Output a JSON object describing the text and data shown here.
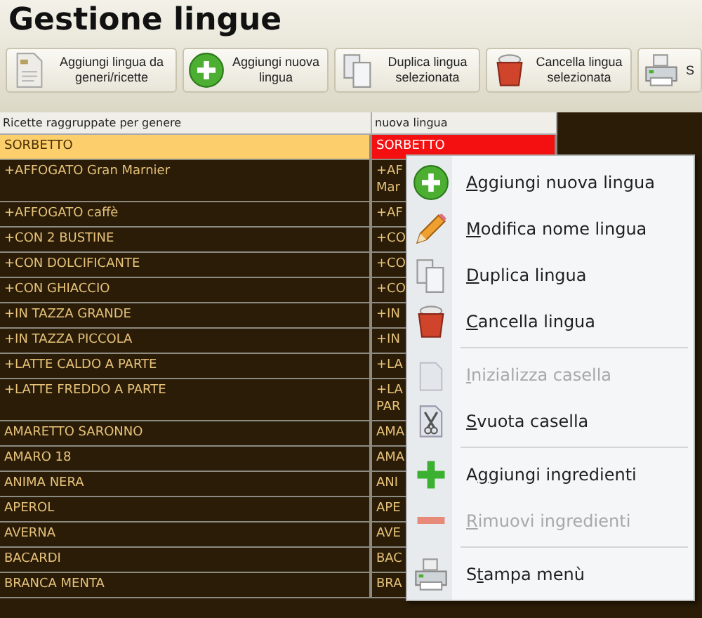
{
  "window": {
    "title": "Gestione lingue"
  },
  "toolbar": [
    {
      "label": "Aggiungi lingua da generi/ricette"
    },
    {
      "label": "Aggiungi nuova lingua"
    },
    {
      "label": "Duplica lingua selezionata"
    },
    {
      "label": "Cancella lingua selezionata"
    },
    {
      "label": "S"
    }
  ],
  "table": {
    "columns": [
      "Ricette raggruppate per genere",
      "nuova lingua"
    ],
    "rows": [
      {
        "name": "SORBETTO",
        "column_2": "SORBETTO",
        "selected": true
      },
      {
        "name": "+AFFOGATO Gran Marnier",
        "column_2": "+AF\nMar",
        "selected": false
      },
      {
        "name": "+AFFOGATO caffè",
        "column_2": "+AF",
        "selected": false
      },
      {
        "name": "+CON 2 BUSTINE",
        "column_2": "+CO",
        "selected": false
      },
      {
        "name": "+CON DOLCIFICANTE",
        "column_2": "+CO",
        "selected": false
      },
      {
        "name": "+CON GHIACCIO",
        "column_2": "+CO",
        "selected": false
      },
      {
        "name": "+IN TAZZA GRANDE",
        "column_2": "+IN",
        "selected": false
      },
      {
        "name": "+IN TAZZA PICCOLA",
        "column_2": "+IN",
        "selected": false
      },
      {
        "name": "+LATTE CALDO A PARTE",
        "column_2": "+LA",
        "selected": false
      },
      {
        "name": "+LATTE FREDDO A PARTE",
        "column_2": "+LA\nPAR",
        "selected": false
      },
      {
        "name": "AMARETTO SARONNO",
        "column_2": "AMA",
        "selected": false
      },
      {
        "name": "AMARO 18",
        "column_2": "AMA",
        "selected": false
      },
      {
        "name": "ANIMA NERA",
        "column_2": "ANI",
        "selected": false
      },
      {
        "name": "APEROL",
        "column_2": "APE",
        "selected": false
      },
      {
        "name": "AVERNA",
        "column_2": "AVE",
        "selected": false
      },
      {
        "name": "BACARDI",
        "column_2": "BAC",
        "selected": false
      },
      {
        "name": "BRANCA MENTA",
        "column_2": "BRA",
        "selected": false
      }
    ]
  },
  "context_menu": [
    {
      "kind": "item",
      "label": "Aggiungi nuova lingua",
      "disabled": false
    },
    {
      "kind": "item",
      "label": "Modifica nome lingua",
      "disabled": false
    },
    {
      "kind": "item",
      "label": "Duplica lingua",
      "disabled": false
    },
    {
      "kind": "item",
      "label": "Cancella lingua",
      "disabled": false
    },
    {
      "kind": "separator"
    },
    {
      "kind": "item",
      "label": "Inizializza casella",
      "disabled": true
    },
    {
      "kind": "item",
      "label": "Svuota casella",
      "disabled": false
    },
    {
      "kind": "separator"
    },
    {
      "kind": "item",
      "label": "Aggiungi ingredienti",
      "disabled": false
    },
    {
      "kind": "item",
      "label": "Rimuovi ingredienti",
      "disabled": true
    },
    {
      "kind": "separator"
    },
    {
      "kind": "item",
      "label": "Stampa menù",
      "disabled": false
    }
  ]
}
